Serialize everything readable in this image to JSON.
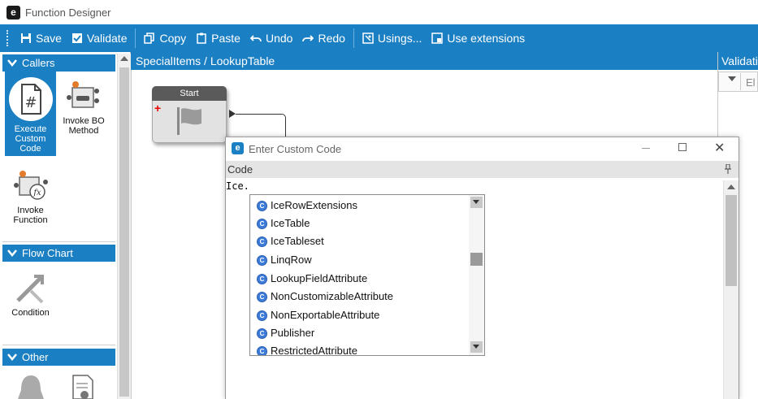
{
  "window": {
    "title": "Function Designer",
    "logo_letter": "e"
  },
  "toolbar": {
    "save": "Save",
    "validate": "Validate",
    "copy": "Copy",
    "paste": "Paste",
    "undo": "Undo",
    "redo": "Redo",
    "usings": "Usings...",
    "use_extensions": "Use extensions"
  },
  "palette": {
    "callers": {
      "title": "Callers",
      "items": [
        "Execute Custom Code",
        "Invoke BO Method",
        "Invoke Function"
      ]
    },
    "flow_chart": {
      "title": "Flow Chart",
      "items": [
        "Condition"
      ]
    },
    "other": {
      "title": "Other"
    }
  },
  "designer": {
    "breadcrumb": "SpecialItems / LookupTable",
    "start_node": "Start"
  },
  "validation": {
    "title": "Validation",
    "column": "El"
  },
  "dialog": {
    "title": "Enter Custom Code",
    "logo_letter": "e",
    "code_label": "Code",
    "code_text": "Ice."
  },
  "completion": {
    "items": [
      "IceRowExtensions",
      "IceTable",
      "IceTableset",
      "LinqRow",
      "LookupFieldAttribute",
      "NonCustomizableAttribute",
      "NonExportableAttribute",
      "Publisher",
      "RestrictedAttribute"
    ]
  },
  "colors": {
    "accent": "#1b7fc3",
    "toolbar_text": "#ffffff"
  }
}
